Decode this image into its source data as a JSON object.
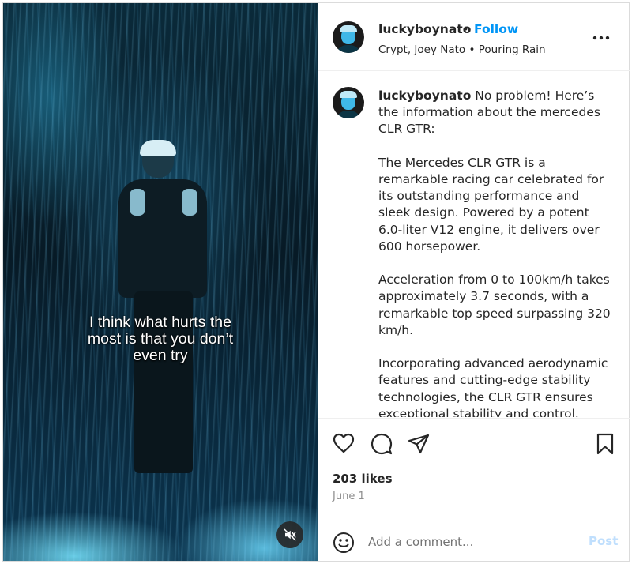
{
  "media": {
    "caption_lines": [
      "I think what hurts the",
      "most is that you don’t",
      "even try"
    ],
    "mute_icon": "speaker-muted-icon"
  },
  "header": {
    "username": "luckyboynato",
    "separator": "•",
    "follow_label": "Follow",
    "audio_artists": "Crypt, Joey Nato",
    "audio_separator": "•",
    "audio_track": "Pouring Rain",
    "more_icon": "more-options-icon"
  },
  "comment": {
    "username": "luckyboynato",
    "text": " No problem! Here’s the information about the mercedes CLR GTR:\n\nThe Mercedes CLR GTR is a remarkable racing car celebrated for its outstanding performance and sleek design. Powered by a potent 6.0-liter V12 engine, it delivers over 600 horsepower.\n\nAcceleration from 0 to 100km/h takes approximately 3.7 seconds, with a remarkable top speed surpassing 320 km/h.\n\nIncorporating advanced aerodynamic features and cutting-edge stability technologies, the CLR GTR ensures exceptional stability and control."
  },
  "actions": {
    "icons": [
      "heart-icon",
      "comment-icon",
      "share-icon",
      "bookmark-icon"
    ],
    "likes": "203 likes",
    "date": "June 1"
  },
  "comment_bar": {
    "emoji_icon": "emoji-icon",
    "placeholder": "Add a comment...",
    "post_label": "Post"
  },
  "colors": {
    "accent": "#0095f6",
    "post_disabled": "#c0dffd",
    "muted_text": "#8e8e8e"
  }
}
